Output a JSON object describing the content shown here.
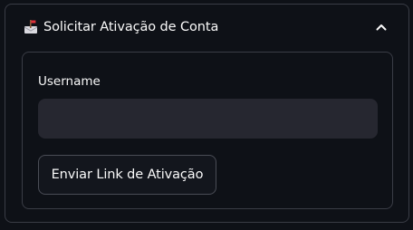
{
  "expander": {
    "icon": "mailbox-icon",
    "title": "Solicitar Ativação de Conta",
    "state_icon": "chevron-up-icon"
  },
  "form": {
    "username_label": "Username",
    "username_value": "",
    "username_placeholder": "",
    "submit_label": "Enviar Link de Ativação"
  },
  "colors": {
    "background": "#0e1117",
    "border": "#3a3d46",
    "input_background": "#262730",
    "text": "#fafafa",
    "mailbox_red": "#e0303a"
  }
}
